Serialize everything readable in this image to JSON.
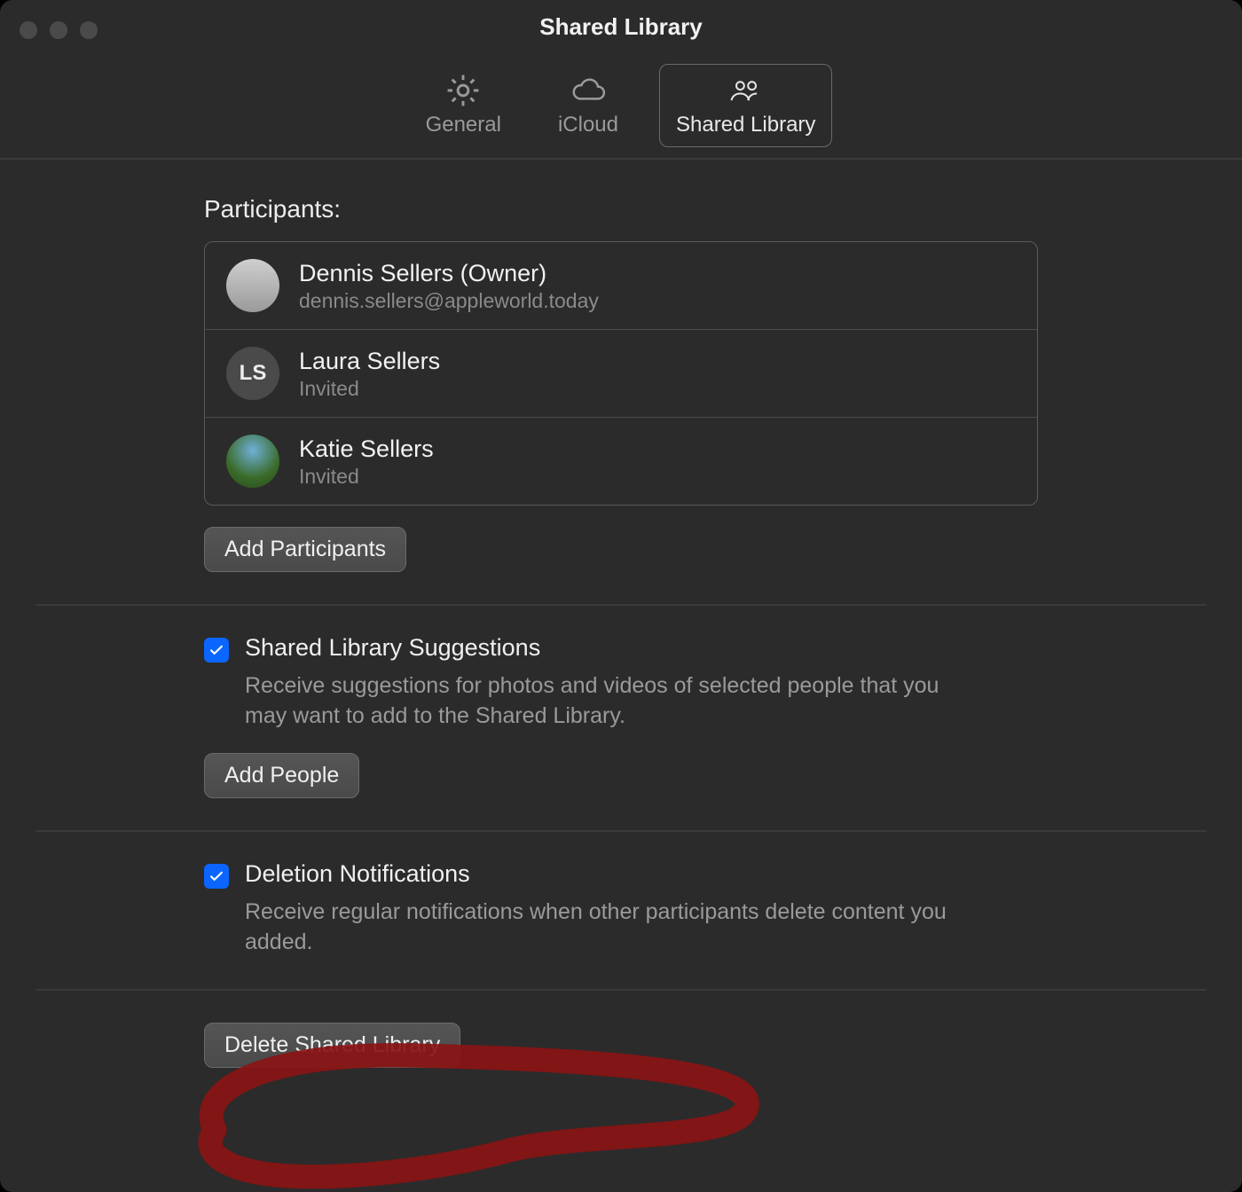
{
  "window": {
    "title": "Shared Library"
  },
  "tabs": {
    "general": "General",
    "icloud": "iCloud",
    "shared": "Shared Library"
  },
  "participants": {
    "heading": "Participants:",
    "list": [
      {
        "name": "Dennis Sellers (Owner)",
        "sub": "dennis.sellers@appleworld.today",
        "avatar_kind": "memoji",
        "avatar_initials": ""
      },
      {
        "name": "Laura Sellers",
        "sub": "Invited",
        "avatar_kind": "initials",
        "avatar_initials": "LS"
      },
      {
        "name": "Katie Sellers",
        "sub": "Invited",
        "avatar_kind": "photo",
        "avatar_initials": ""
      }
    ],
    "add_button": "Add Participants"
  },
  "suggestions": {
    "title": "Shared Library Suggestions",
    "desc": "Receive suggestions for photos and videos of selected people that you may want to add to the Shared Library.",
    "button": "Add People",
    "checked": true
  },
  "deletion": {
    "title": "Deletion Notifications",
    "desc": "Receive regular notifications when other participants delete content you added.",
    "checked": true
  },
  "delete_button": "Delete Shared Library",
  "colors": {
    "accent": "#0a66ff",
    "annotation": "#8a1414"
  }
}
